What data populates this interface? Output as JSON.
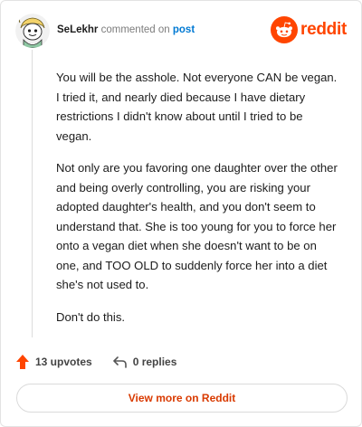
{
  "comment": {
    "username": "SeLekhr",
    "action_text": "commented on",
    "target_link": "post",
    "paragraphs": [
      "You will be the asshole. Not everyone CAN be vegan. I tried it, and nearly died because I have dietary restrictions I didn't know about until I tried to be vegan.",
      "Not only are you favoring one daughter over the other and being overly controlling, you are risking your adopted daughter's health, and you don't seem to understand that. She is too young for you to force her onto a vegan diet when she doesn't want to be on one, and TOO OLD to suddenly force her into a diet she's not used to.",
      "Don't do this."
    ]
  },
  "brand": {
    "wordmark": "reddit",
    "color": "#ff4500"
  },
  "actions": {
    "upvotes_label": "13 upvotes",
    "replies_label": "0 replies"
  },
  "footer": {
    "view_more_label": "View more on Reddit"
  },
  "icons": {
    "avatar": "snoo-avatar-icon",
    "logo": "reddit-logo-icon",
    "upvote": "upvote-arrow-icon",
    "reply": "reply-arrow-icon"
  }
}
